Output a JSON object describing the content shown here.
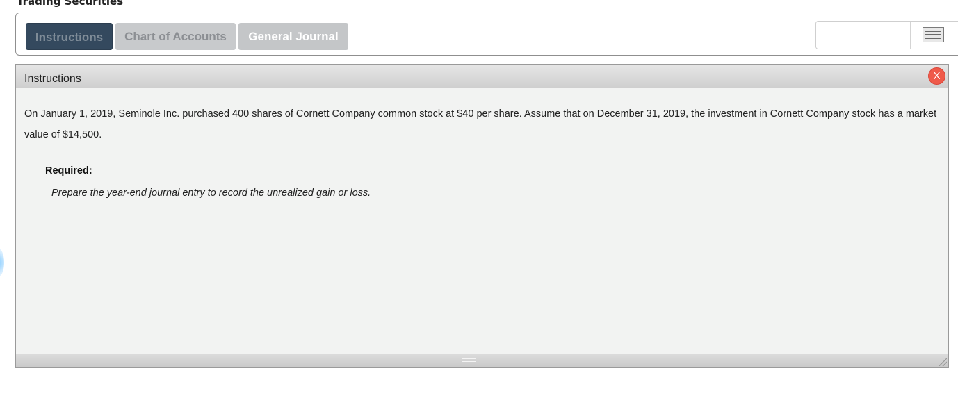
{
  "page": {
    "title": "Trading Securities"
  },
  "tabs": [
    {
      "label": "Instructions",
      "active": true
    },
    {
      "label": "Chart of Accounts",
      "active": false
    },
    {
      "label": "General Journal",
      "active": false
    }
  ],
  "toolbar": {
    "menu_icon": "hamburger-menu-icon"
  },
  "panel": {
    "title": "Instructions",
    "close_label": "X",
    "body": "On January 1, 2019, Seminole Inc. purchased 400 shares of Cornett Company common stock at $40 per share. Assume that on December 31, 2019, the investment in Cornett Company stock has a market value of $14,500.",
    "required_label": "Required:",
    "required_text": "Prepare the year-end journal entry to record the unrealized gain or loss."
  },
  "colors": {
    "active_tab": "#34495e",
    "inactive_tab": "#c8cacc",
    "close_button": "#ef5a4a",
    "panel_background": "#f2f3f2"
  }
}
